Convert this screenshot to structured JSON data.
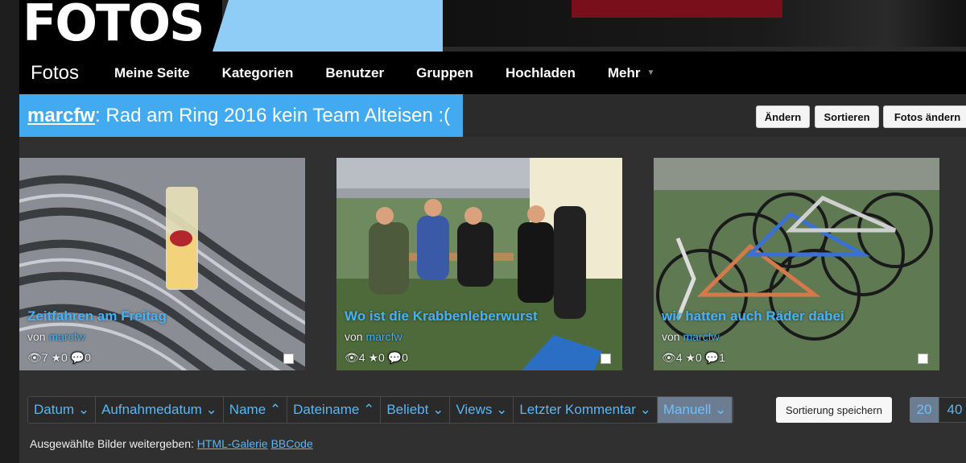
{
  "logo": {
    "text": "FOTOS"
  },
  "nav": {
    "brand": "Fotos",
    "items": [
      "Meine Seite",
      "Kategorien",
      "Benutzer",
      "Gruppen",
      "Hochladen",
      "Mehr"
    ]
  },
  "album": {
    "user": "marcfw",
    "title": ": Rad am Ring 2016 kein Team Alteisen :(",
    "buttons": [
      "Ändern",
      "Sortieren",
      "Fotos ändern"
    ]
  },
  "photos": [
    {
      "caption": "Zeitfahren am Freitag",
      "by_label": "von",
      "author": "marcfw",
      "views": "7",
      "stars": "0",
      "comments": "0"
    },
    {
      "caption": "Wo ist die Krabbenleberwurst",
      "by_label": "von",
      "author": "marcfw",
      "views": "4",
      "stars": "0",
      "comments": "0"
    },
    {
      "caption": "wir hatten auch Räder dabei",
      "by_label": "von",
      "author": "marcfw",
      "views": "4",
      "stars": "0",
      "comments": "1"
    }
  ],
  "sort": {
    "items": [
      {
        "label": "Datum",
        "arrow": "⌄"
      },
      {
        "label": "Aufnahmedatum",
        "arrow": "⌄"
      },
      {
        "label": "Name",
        "arrow": "⌃"
      },
      {
        "label": "Dateiname",
        "arrow": "⌃"
      },
      {
        "label": "Beliebt",
        "arrow": "⌄"
      },
      {
        "label": "Views",
        "arrow": "⌄"
      },
      {
        "label": "Letzter Kommentar",
        "arrow": "⌄"
      },
      {
        "label": "Manuell",
        "arrow": "⌄"
      }
    ],
    "save_label": "Sortierung speichern",
    "per_page": [
      "20",
      "40"
    ]
  },
  "share": {
    "label": "Ausgewählte Bilder weitergeben:",
    "links": [
      "HTML-Galerie",
      "BBCode"
    ]
  },
  "colors": {
    "accent": "#42aaf0",
    "link": "#5ab7f5",
    "active_sort": "#6c7d92"
  }
}
